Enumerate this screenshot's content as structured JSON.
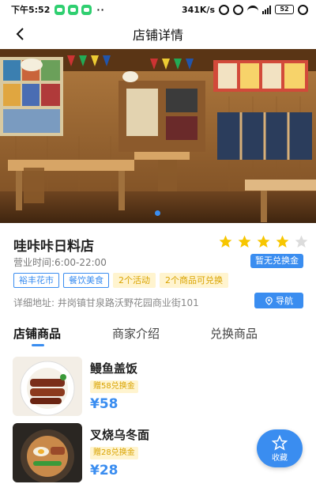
{
  "status_bar": {
    "time": "下午5:52",
    "network": "341K/s",
    "battery": "52"
  },
  "header": {
    "title": "店铺详情"
  },
  "shop": {
    "name": "哇咔咔日料店",
    "rating": 4,
    "rating_max": 5,
    "hours": "营业时间:6:00-22:00",
    "no_coupon_label": "暂无兑换金",
    "tags": [
      "裕丰花市",
      "餐饮美食",
      "2个活动",
      "2个商品可兑换"
    ],
    "address": "详细地址: 井岗镇甘泉路沃野花园商业街101",
    "nav_label": "导航"
  },
  "tabs": [
    {
      "label": "店铺商品",
      "active": true
    },
    {
      "label": "商家介绍",
      "active": false
    },
    {
      "label": "兑换商品",
      "active": false
    }
  ],
  "products": [
    {
      "name": "鳗鱼盖饭",
      "coupon": "赠58兑换金",
      "price": "¥58"
    },
    {
      "name": "叉烧乌冬面",
      "coupon": "赠28兑换金",
      "price": "¥28"
    }
  ],
  "fab": {
    "label": "收藏"
  },
  "colors": {
    "accent": "#3a8df0",
    "star": "#f7c600",
    "coupon_bg": "#fff4cf",
    "coupon_text": "#d9a300"
  }
}
